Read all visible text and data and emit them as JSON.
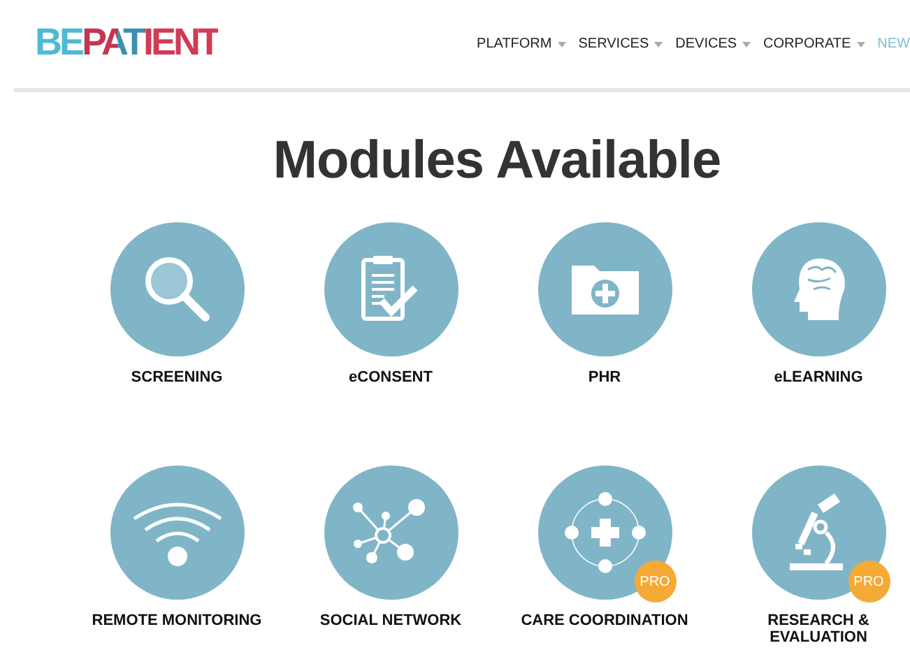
{
  "header": {
    "logo": "BEPATIENT",
    "nav": [
      {
        "label": "PLATFORM",
        "dropdown": true,
        "selected": false
      },
      {
        "label": "SERVICES",
        "dropdown": true,
        "selected": false
      },
      {
        "label": "DEVICES",
        "dropdown": true,
        "selected": false
      },
      {
        "label": "CORPORATE",
        "dropdown": true,
        "selected": false
      },
      {
        "label": "NEW",
        "dropdown": false,
        "selected": true
      }
    ]
  },
  "title": "Modules Available",
  "modules": [
    {
      "kind": "search",
      "label": "SCREENING",
      "pro": false
    },
    {
      "kind": "clipboard",
      "label": "eCONSENT",
      "pro": false
    },
    {
      "kind": "folder",
      "label": "PHR",
      "pro": false
    },
    {
      "kind": "brain",
      "label": "eLEARNING",
      "pro": false
    },
    {
      "kind": "wifi",
      "label": "REMOTE MONITORING",
      "pro": false
    },
    {
      "kind": "network",
      "label": "SOCIAL NETWORK",
      "pro": false
    },
    {
      "kind": "care",
      "label": "CARE COORDINATION",
      "pro": true,
      "badge": "PRO"
    },
    {
      "kind": "microscope",
      "label": "RESEARCH & EVALUATION",
      "pro": true,
      "badge": "PRO"
    }
  ]
}
